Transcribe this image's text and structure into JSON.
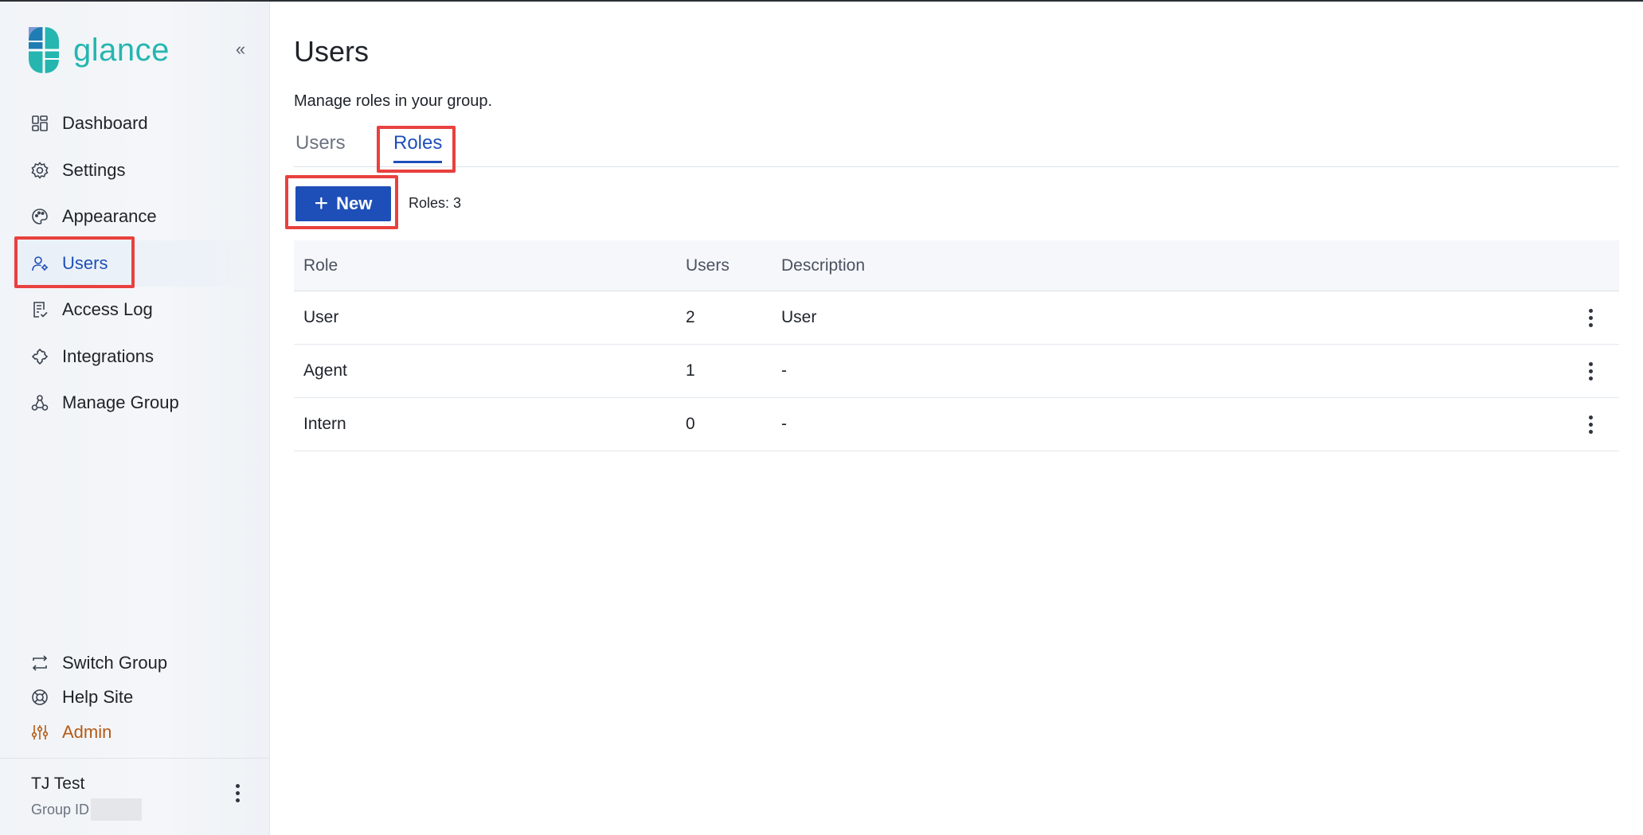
{
  "brand": {
    "name": "glance",
    "color": "#25b6b0"
  },
  "sidebar": {
    "collapse_icon": "chevrons-left-icon",
    "items": [
      {
        "label": "Dashboard",
        "icon": "dashboard-icon"
      },
      {
        "label": "Settings",
        "icon": "gear-icon"
      },
      {
        "label": "Appearance",
        "icon": "palette-icon"
      },
      {
        "label": "Users",
        "icon": "user-gear-icon",
        "active": true
      },
      {
        "label": "Access Log",
        "icon": "document-check-icon"
      },
      {
        "label": "Integrations",
        "icon": "puzzle-icon"
      },
      {
        "label": "Manage Group",
        "icon": "group-tree-icon"
      }
    ],
    "bottom_items": [
      {
        "label": "Switch Group",
        "icon": "switch-arrows-icon"
      },
      {
        "label": "Help Site",
        "icon": "lifebuoy-icon"
      },
      {
        "label": "Admin",
        "icon": "sliders-icon",
        "color": "#b55a15"
      }
    ],
    "user": {
      "name": "TJ Test",
      "group_id_label": "Group ID"
    }
  },
  "main": {
    "title": "Users",
    "subtitle": "Manage roles in your group.",
    "tabs": [
      {
        "label": "Users",
        "active": false
      },
      {
        "label": "Roles",
        "active": true
      }
    ],
    "new_button_label": "New",
    "roles_count_text": "Roles: 3",
    "table": {
      "headers": [
        "Role",
        "Users",
        "Description"
      ],
      "rows": [
        {
          "role": "User",
          "users": "2",
          "description": "User"
        },
        {
          "role": "Agent",
          "users": "1",
          "description": "-"
        },
        {
          "role": "Intern",
          "users": "0",
          "description": "-"
        }
      ]
    }
  },
  "colors": {
    "accent": "#1e4fb8",
    "highlight": "#e8413f",
    "admin": "#b55a15"
  }
}
